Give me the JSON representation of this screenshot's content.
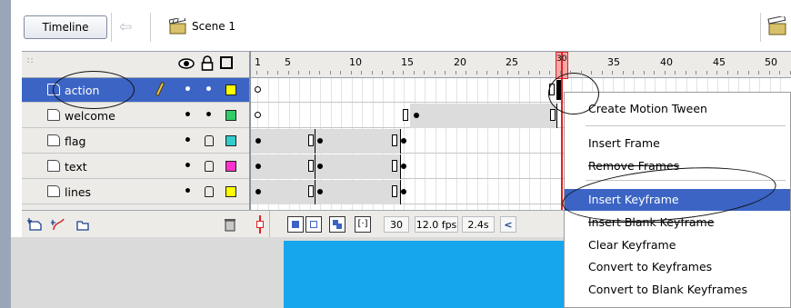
{
  "toolbar": {
    "timeline_button": "Timeline",
    "scene_label": "Scene 1"
  },
  "timeline": {
    "frame_ticks": [
      "1",
      "5",
      "10",
      "15",
      "20",
      "25",
      "30",
      "35",
      "40",
      "45",
      "50"
    ],
    "current_frame_marker": "30",
    "layers": [
      {
        "name": "action",
        "selected": true,
        "color": "#ffff00",
        "locked": false
      },
      {
        "name": "welcome",
        "selected": false,
        "color": "#33cc66",
        "locked": false
      },
      {
        "name": "flag",
        "selected": false,
        "color": "#33cccc",
        "locked": true
      },
      {
        "name": "text",
        "selected": false,
        "color": "#ff33cc",
        "locked": true
      },
      {
        "name": "lines",
        "selected": false,
        "color": "#ffff00",
        "locked": true
      }
    ],
    "status": {
      "frame": "30",
      "fps": "12.0 fps",
      "time": "2.4s"
    }
  },
  "context_menu": {
    "items": [
      {
        "label": "Create Motion Tween",
        "highlighted": false
      },
      {
        "label": "Insert Frame",
        "highlighted": false
      },
      {
        "label": "Remove Frames",
        "highlighted": false,
        "struck": true
      },
      {
        "label": "Insert Keyframe",
        "highlighted": true
      },
      {
        "label": "Insert Blank Keyframe",
        "highlighted": false,
        "struck": true
      },
      {
        "label": "Clear Keyframe",
        "highlighted": false
      },
      {
        "label": "Convert to Keyframes",
        "highlighted": false
      },
      {
        "label": "Convert to Blank Keyframes",
        "highlighted": false
      }
    ]
  },
  "colors": {
    "selection": "#3b64c4",
    "playhead": "#e02020",
    "stage": "#16a6ee"
  }
}
